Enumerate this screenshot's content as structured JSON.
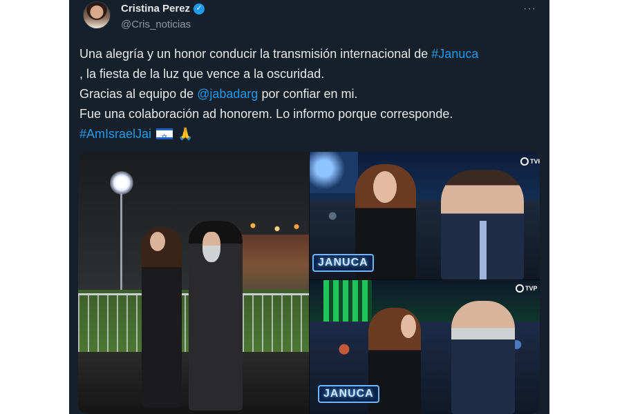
{
  "author": {
    "name": "Cristina Perez",
    "handle": "@Cris_noticias",
    "verified": true
  },
  "menu": {
    "more_label": "···"
  },
  "tweet": {
    "line1_text": "Una alegría y un honor conducir la transmisión internacional de ",
    "line1_hashtag": "#Januca",
    "line2_text": ", la fiesta de la luz que vence a la oscuridad.",
    "line3_text": "Gracias al equipo de ",
    "line3_mention": "@jabadarg",
    "line3_text_after": " por confiar en mi.",
    "line4_text": " Fue una colaboración ad honorem. Lo informo porque corresponde.",
    "line5_hashtag": "#AmIsraelJai"
  },
  "media": {
    "overlay_logo": "JANUCA",
    "channel_logo": "TVP"
  },
  "icons": [
    "verified-icon",
    "more-options-icon",
    "israel-flag-icon",
    "folded-hands-icon"
  ],
  "colors": {
    "background": "#15202b",
    "text": "#e7e9ea",
    "secondary": "#8b98a5",
    "link": "#1d9bf0"
  }
}
